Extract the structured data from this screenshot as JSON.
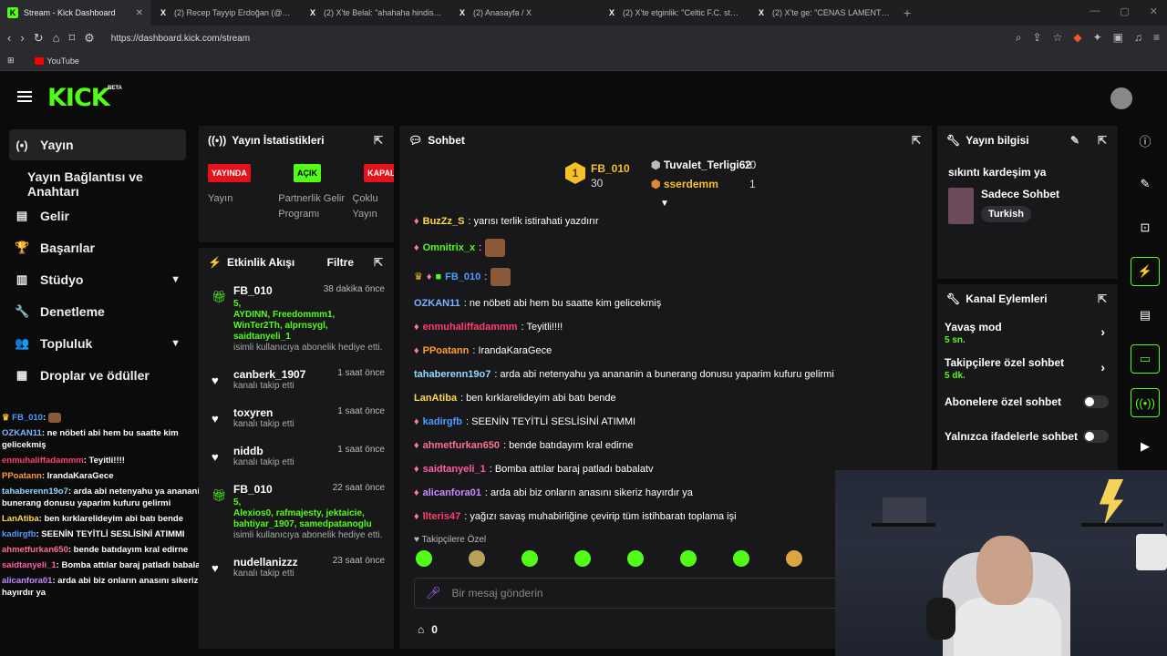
{
  "browser": {
    "tabs": [
      {
        "title": "Stream - Kick Dashboard",
        "active": true,
        "icon": "K"
      },
      {
        "title": "(2) Recep Tayyip Erdoğan (@RTErdog",
        "icon": "X"
      },
      {
        "title": "(2) X'te Belal: \"ahahaha hindistanda",
        "icon": "X"
      },
      {
        "title": "(2) Anasayfa / X",
        "icon": "X"
      },
      {
        "title": "(2) X'te etginlik: \"Celtic F.C. stadyumu",
        "icon": "X"
      },
      {
        "title": "(2) X'te ge: \"CENAS LAMENTÁVEIS! F",
        "icon": "X"
      }
    ],
    "url": "https://dashboard.kick.com/stream",
    "bookmark": "YouTube"
  },
  "header": {
    "logo": "KICK",
    "beta": "BETA"
  },
  "sidebar": {
    "items": [
      {
        "label": "Yayın",
        "icon": "(•)"
      },
      {
        "label": "Yayın Bağlantısı ve Anahtarı"
      },
      {
        "label": "Gelir",
        "icon": "▤"
      },
      {
        "label": "Başarılar",
        "icon": "🏆"
      },
      {
        "label": "Stüdyo",
        "icon": "▥"
      },
      {
        "label": "Denetleme",
        "icon": "🔧"
      },
      {
        "label": "Topluluk",
        "icon": "👥"
      },
      {
        "label": "Droplar ve ödüller",
        "icon": "▦"
      }
    ]
  },
  "overlay_chat": [
    {
      "user": "FB_010",
      "text": "",
      "color": "#4d9cff"
    },
    {
      "user": "OZKAN11",
      "text": ": ne nöbeti abi hem bu saatte kim gelicekmiş",
      "color": "#7fb2ff"
    },
    {
      "user": "enmuhaliffadammm",
      "text": ": Teyitli!!!!",
      "color": "#ff3f6e"
    },
    {
      "user": "PPoatann",
      "text": ": IrandaKaraGece",
      "color": "#ff9d2e"
    },
    {
      "user": "tahaberenn19o7",
      "text": ": arda abi netenyahu ya anananin a bunerang donusu yaparim kufuru gelirmi",
      "color": "#8fd9ff"
    },
    {
      "user": "LanAtiba",
      "text": ": ben kırklarelideyim abi batı bende",
      "color": "#ffd84d"
    },
    {
      "user": "kadirgfb",
      "text": ": SEENİN TEYİTLİ SESLİSİNİ ATIMMI",
      "color": "#4d9cff"
    },
    {
      "user": "ahmetfurkan650",
      "text": ": bende batıdayım kral edirne",
      "color": "#ff6f8f"
    },
    {
      "user": "saidtanyeli_1",
      "text": ": Bomba attılar baraj patladı babalatv",
      "color": "#ff5fa2"
    },
    {
      "user": "alicanfora01",
      "text": ": arda abi biz onların anasını sikeriz hayırdır ya",
      "color": "#c58bff"
    }
  ],
  "stats": {
    "title": "Yayın İstatistikleri",
    "badges": [
      "YAYINDA",
      "AÇIK",
      "KAPALI"
    ],
    "labels": [
      "Yayın",
      "Partnerlik Gelir Programı",
      "Çoklu Yayın"
    ]
  },
  "activity": {
    "title": "Etkinlik Akışı",
    "filter": "Filtre",
    "items": [
      {
        "name": "FB_010",
        "time": "38 dakika önce",
        "type": "gift",
        "count": "5,",
        "names": "AYDINN, Freedommm1, WinTer2Th, alprnsygl, saidtanyeli_1",
        "sub": "isimli kullanıcıya abonelik hediye etti."
      },
      {
        "name": "canberk_1907",
        "time": "1 saat önce",
        "type": "follow",
        "sub": "kanalı takip etti"
      },
      {
        "name": "toxyren",
        "time": "1 saat önce",
        "type": "follow",
        "sub": "kanalı takip etti"
      },
      {
        "name": "niddb",
        "time": "1 saat önce",
        "type": "follow",
        "sub": "kanalı takip etti"
      },
      {
        "name": "FB_010",
        "time": "22 saat önce",
        "type": "gift",
        "count": "5,",
        "names": "Alexios0, rafmajesty, jektaicie, bahtiyar_1907, samedpatanoglu",
        "sub": "isimli kullanıcıya abonelik hediye etti."
      },
      {
        "name": "nudellanizzz",
        "time": "23 saat önce",
        "type": "follow",
        "sub": "kanalı takip etti"
      }
    ]
  },
  "chat": {
    "title": "Sohbet",
    "top_gifters": [
      {
        "name": "FB_010",
        "value": "30",
        "rank": "1"
      },
      {
        "name": "Tuvalet_Terligi62",
        "value": "10"
      },
      {
        "name": "sserdemm",
        "value": "1"
      }
    ],
    "messages": [
      {
        "user": "BuzZz_S",
        "text": ": yarısı terlik istirahati yazdırır",
        "color": "#ffd84d"
      },
      {
        "user": "Omnitrix_x",
        "text": ":",
        "color": "#53fc18",
        "emote": true
      },
      {
        "user": "FB_010",
        "text": ":",
        "color": "#4d9cff",
        "emote": true
      },
      {
        "user": "OZKAN11",
        "text": ": ne nöbeti abi hem bu saatte kim gelicekmiş",
        "color": "#7fb2ff"
      },
      {
        "user": "enmuhaliffadammm",
        "text": ": Teyitli!!!!",
        "color": "#ff3f6e"
      },
      {
        "user": "PPoatann",
        "text": ": IrandaKaraGece",
        "color": "#ff9d2e"
      },
      {
        "user": "tahaberenn19o7",
        "text": ": arda abi netenyahu ya anananin a bunerang donusu yaparim kufuru gelirmi",
        "color": "#8fd9ff"
      },
      {
        "user": "LanAtiba",
        "text": ": ben kırklarelideyim abi batı bende",
        "color": "#ffd84d"
      },
      {
        "user": "kadirgfb",
        "text": ": SEENİN TEYİTLİ SESLİSİNİ ATIMMI",
        "color": "#4d9cff"
      },
      {
        "user": "ahmetfurkan650",
        "text": ": bende batıdayım kral edirne",
        "color": "#ff6f8f"
      },
      {
        "user": "saidtanyeli_1",
        "text": ": Bomba attılar baraj patladı babalatv",
        "color": "#ff5fa2"
      },
      {
        "user": "alicanfora01",
        "text": ": arda abi biz onların anasını sikeriz hayırdır ya",
        "color": "#c58bff"
      },
      {
        "user": "llteris47",
        "text": ": yağızı savaş muhabirliğine çevirip tüm istihbaratı toplama işi",
        "color": "#ff3f6e"
      }
    ],
    "followers_label": "Takipçilere Özel",
    "input_placeholder": "Bir mesaj gönderin",
    "points": "0"
  },
  "info": {
    "title": "Yayın bilgisi",
    "stream_title": "sıkıntı kardeşim ya",
    "category": "Sadece Sohbet",
    "language": "Turkish"
  },
  "channel_actions": {
    "title": "Kanal Eylemleri",
    "rows": [
      {
        "label": "Yavaş mod",
        "value": "5 sn."
      },
      {
        "label": "Takipçilere özel sohbet",
        "value": "5 dk."
      },
      {
        "label": "Abonelere özel sohbet"
      },
      {
        "label": "Yalnızca ifadelerle sohbet"
      }
    ]
  },
  "colors": {
    "accent": "#53fc18",
    "live": "#e6121b",
    "panel": "#18181b",
    "bg": "#0b0b0c"
  }
}
